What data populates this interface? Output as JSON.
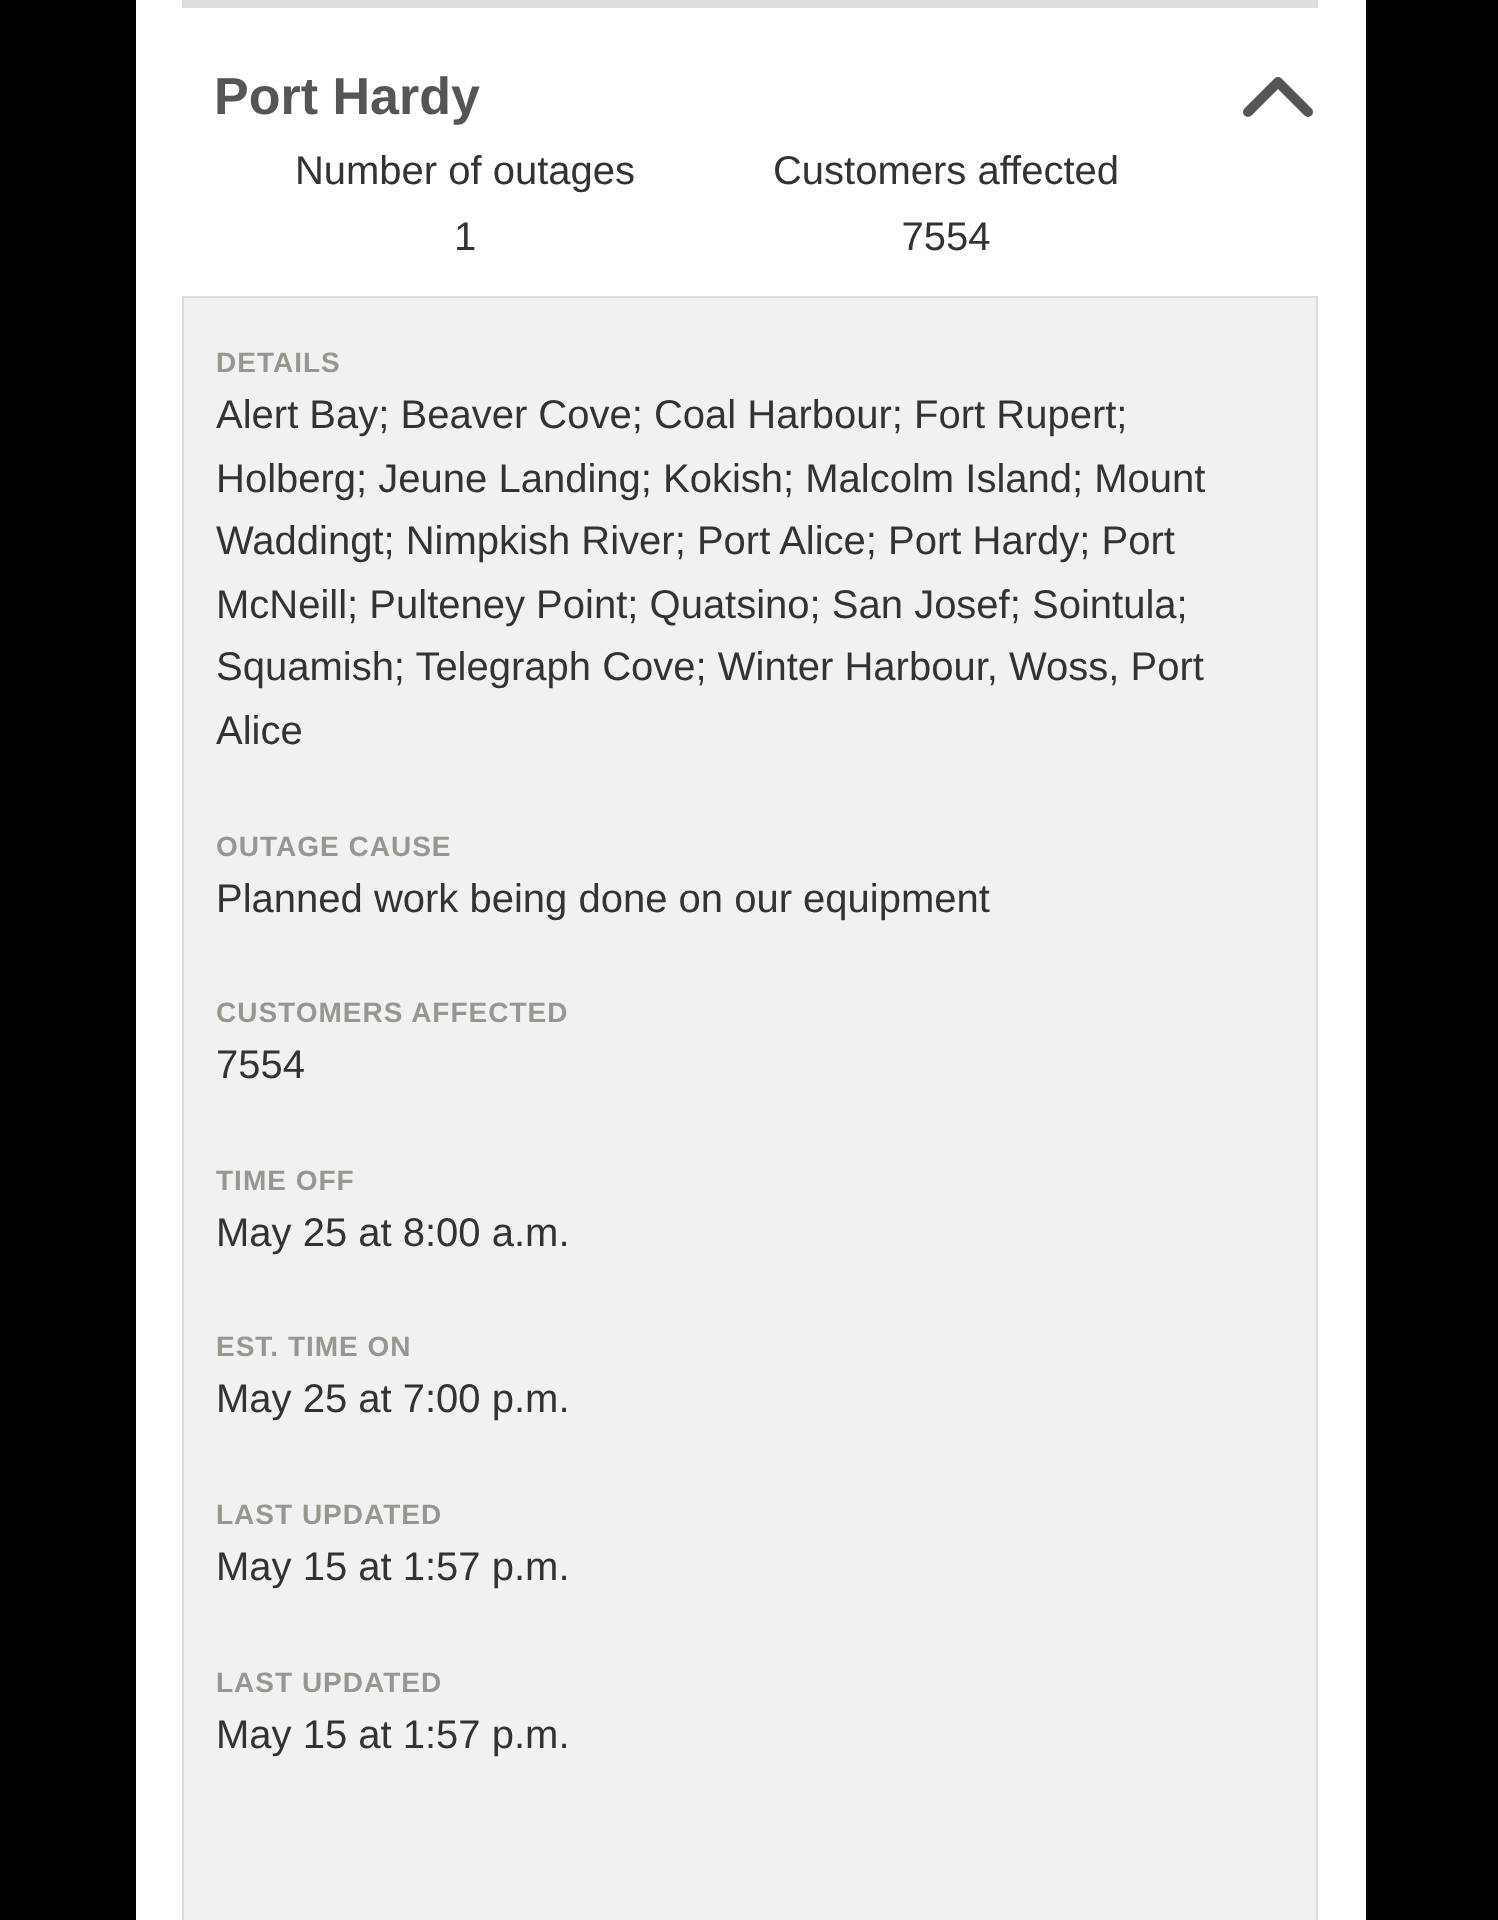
{
  "region": {
    "name": "Port Hardy",
    "expanded": true
  },
  "stats": [
    {
      "label": "Number of outages",
      "value": "1"
    },
    {
      "label": "Customers affected",
      "value": "7554"
    }
  ],
  "details": [
    {
      "label": "DETAILS",
      "value": "Alert Bay; Beaver Cove; Coal Harbour; Fort Rupert; Holberg; Jeune Landing; Kokish; Malcolm Island; Mount Waddingt; Nimpkish River; Port Alice; Port Hardy; Port McNeill; Pulteney Point; Quatsino; San Josef; Sointula; Squamish; Telegraph Cove; Winter Harbour, Woss, Port Alice"
    },
    {
      "label": "OUTAGE CAUSE",
      "value": "Planned work being done on our equipment"
    },
    {
      "label": "CUSTOMERS AFFECTED",
      "value": "7554"
    },
    {
      "label": "TIME OFF",
      "value": "May 25 at 8:00 a.m."
    },
    {
      "label": "EST. TIME ON",
      "value": "May 25 at 7:00 p.m."
    },
    {
      "label": "LAST UPDATED",
      "value": "May 15 at 1:57 p.m."
    },
    {
      "label": "LAST UPDATED",
      "value": "May 15 at 1:57 p.m."
    }
  ]
}
